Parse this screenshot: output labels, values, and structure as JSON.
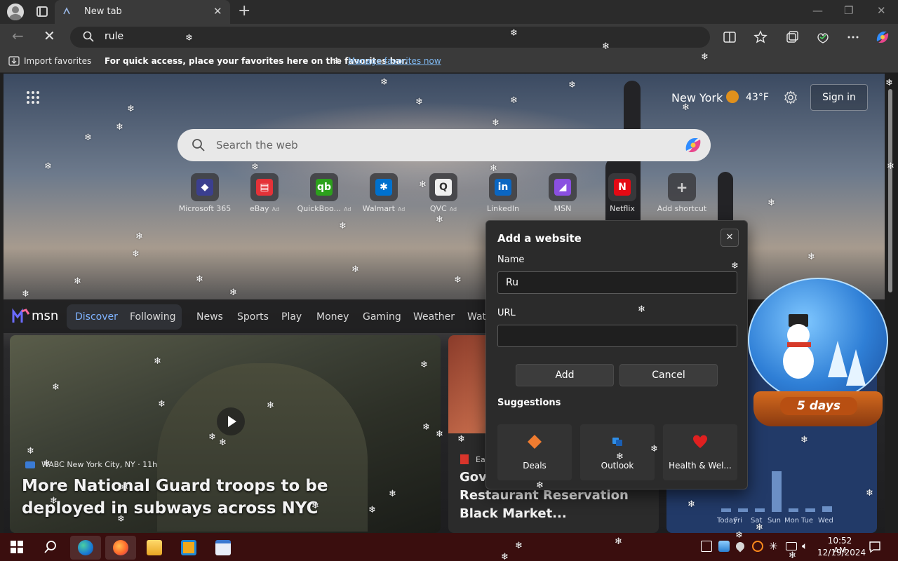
{
  "titlebar": {
    "tab_title": "New tab",
    "tab_close": "✕",
    "new_tab": "+",
    "minimize": "—",
    "restore": "❐",
    "close": "✕"
  },
  "toolbar": {
    "back": "←",
    "stop": "✕",
    "address_value": "rule"
  },
  "favorites_bar": {
    "import_label": "Import favorites",
    "message": "For quick access, place your favorites here on the favorites bar.",
    "manage_link": "Manage favorites now"
  },
  "new_tab_page": {
    "weather": {
      "city": "New York",
      "temp": "43°F"
    },
    "sign_in": "Sign in",
    "search_placeholder": "Search the web",
    "shortcuts": [
      {
        "label": "Microsoft 365",
        "ad": "",
        "glyph": "◆",
        "color": "#3b3f8f"
      },
      {
        "label": "eBay",
        "ad": "Ad",
        "glyph": "▤",
        "color": "#e53238"
      },
      {
        "label": "QuickBoo...",
        "ad": "Ad",
        "glyph": "qb",
        "color": "#2ca01c"
      },
      {
        "label": "Walmart",
        "ad": "Ad",
        "glyph": "✱",
        "color": "#0071ce"
      },
      {
        "label": "QVC",
        "ad": "Ad",
        "glyph": "Q",
        "color": "#ffffff"
      },
      {
        "label": "LinkedIn",
        "ad": "",
        "glyph": "in",
        "color": "#0a66c2"
      },
      {
        "label": "MSN",
        "ad": "",
        "glyph": "◢",
        "color": "#8a4fe0"
      },
      {
        "label": "Netflix",
        "ad": "",
        "glyph": "N",
        "color": "#e50914"
      },
      {
        "label": "Add shortcut",
        "ad": "",
        "glyph": "+",
        "color": "#5a5a5a"
      }
    ]
  },
  "msn": {
    "logo_text": "msn",
    "tabs": [
      "Discover",
      "Following",
      "News",
      "Sports",
      "Play",
      "Money",
      "Gaming",
      "Weather",
      "Wat"
    ],
    "active_tab": "Discover",
    "card_main": {
      "source": "WABC New York City, NY · 11h",
      "title": "More National Guard troops to be deployed in subways across NYC"
    },
    "card_mid": {
      "source": "Ea",
      "title": "Gov... Making the Restaurant Reservation Black Market..."
    },
    "weather_card": {
      "days": [
        "Today",
        "Fri",
        "Sat",
        "Sun",
        "Mon",
        "Tue",
        "Wed"
      ],
      "bars": [
        0.05,
        0.05,
        0.05,
        0.6,
        0.05,
        0.05,
        0.08
      ]
    }
  },
  "dialog": {
    "title": "Add a website",
    "close": "✕",
    "name_label": "Name",
    "name_value": "Ru",
    "url_label": "URL",
    "url_value": "",
    "add_button": "Add",
    "cancel_button": "Cancel",
    "suggestions_title": "Suggestions",
    "suggestions": [
      {
        "label": "Deals",
        "icon": "tag-icon",
        "color": "#f07c30"
      },
      {
        "label": "Outlook",
        "icon": "outlook-icon",
        "color": "#2f8fe8"
      },
      {
        "label": "Health & Wel...",
        "icon": "heart-icon",
        "color": "#e02020"
      }
    ]
  },
  "snow_globe": {
    "label": "5 days"
  },
  "taskbar": {
    "time": "10:52 AM",
    "date": "12/19/2024"
  },
  "colors": {
    "accent": "#7fb3ff",
    "link": "#7fb8f0",
    "taskbar": "#3a0e0e"
  }
}
